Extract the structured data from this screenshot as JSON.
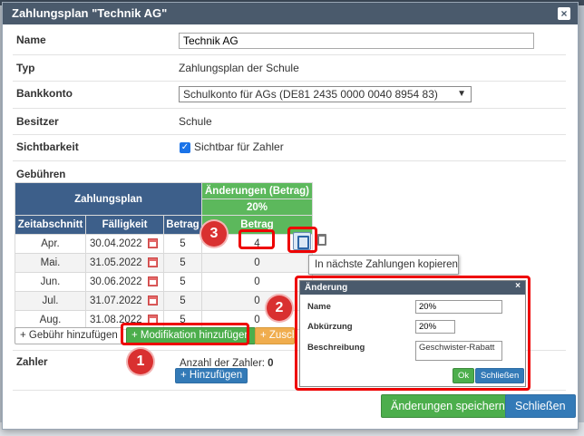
{
  "dialog": {
    "title": "Zahlungsplan \"Technik AG\"",
    "close_symbol": "×"
  },
  "form": {
    "name_label": "Name",
    "name_value": "Technik AG",
    "type_label": "Typ",
    "type_value": "Zahlungsplan der Schule",
    "bank_label": "Bankkonto",
    "bank_value": "Schulkonto für AGs (DE81 2435 0000 0040 8954 83)",
    "owner_label": "Besitzer",
    "owner_value": "Schule",
    "visibility_label": "Sichtbarkeit",
    "visibility_value": "Sichtbar für Zahler",
    "fees_label": "Gebühren"
  },
  "fees_table": {
    "group_header": "Zahlungsplan",
    "changes_header": "Änderungen (Betrag)",
    "changes_percent": "20%",
    "changes_col": "Betrag",
    "columns": [
      "Zeitabschnitt",
      "Fälligkeit",
      "Betrag"
    ],
    "rows": [
      {
        "period": "Apr.",
        "due": "30.04.2022",
        "amount": "5",
        "change": "4"
      },
      {
        "period": "Mai.",
        "due": "31.05.2022",
        "amount": "5",
        "change": "0"
      },
      {
        "period": "Jun.",
        "due": "30.06.2022",
        "amount": "5",
        "change": "0"
      },
      {
        "period": "Jul.",
        "due": "31.07.2022",
        "amount": "5",
        "change": "0"
      },
      {
        "period": "Aug.",
        "due": "31.08.2022",
        "amount": "5",
        "change": "0"
      }
    ]
  },
  "buttons": {
    "add_fee": "+ Gebühr hinzufügen",
    "add_modification": "+ Modifikation hinzufügen",
    "add_surcharge": "+ Zusch",
    "add_payer": "+ Hinzufügen",
    "save": "Änderungen speichern",
    "close": "Schließen"
  },
  "payers": {
    "label": "Zahler",
    "count_text": "Anzahl der Zahler:",
    "count": "0"
  },
  "tooltip": "In nächste Zahlungen kopieren",
  "popup": {
    "title": "Änderung",
    "close_symbol": "×",
    "name_label": "Name",
    "name_value": "20%",
    "abbr_label": "Abkürzung",
    "abbr_value": "20%",
    "desc_label": "Beschreibung",
    "desc_value": "Geschwister-Rabatt",
    "ok": "Ok",
    "close": "Schließen"
  },
  "markers": [
    "1",
    "2",
    "3"
  ],
  "colors": {
    "title_bar": "#4a5a6c",
    "table_header": "#3d5f8a",
    "changes_header": "#5cb85c",
    "highlight": "#ee0000",
    "primary": "#337ab7"
  }
}
